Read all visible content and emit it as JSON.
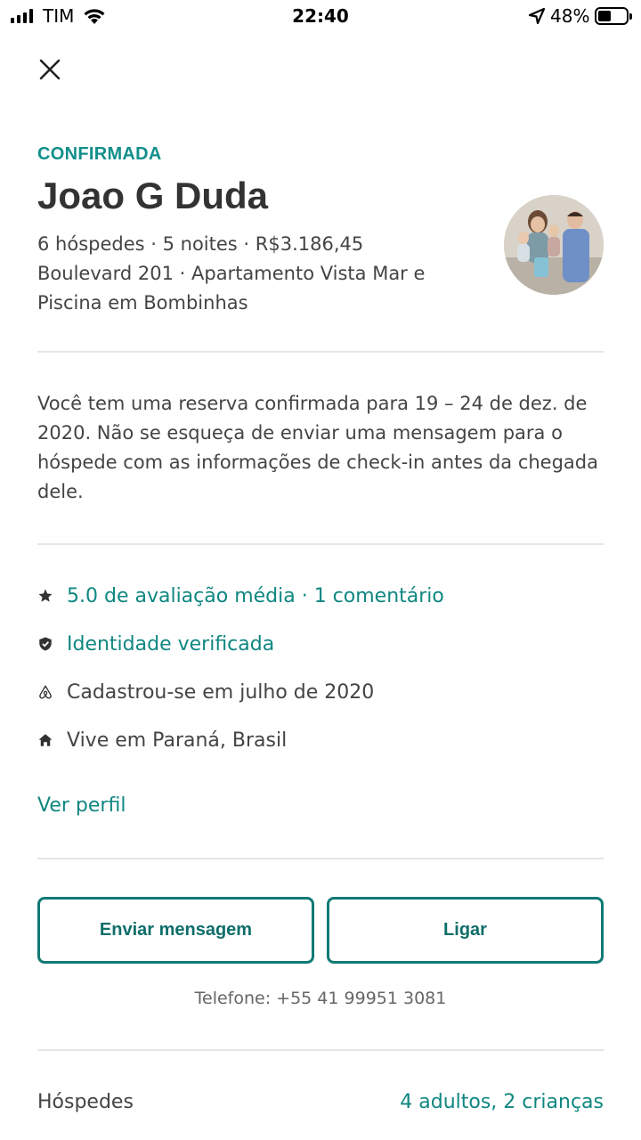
{
  "status_bar": {
    "carrier": "TIM",
    "time": "22:40",
    "battery": "48%",
    "battery_level": 0.48,
    "icons": [
      "signal-icon",
      "wifi-icon",
      "location-arrow-icon",
      "battery-icon"
    ]
  },
  "header": {
    "close_icon": "close-icon"
  },
  "reservation": {
    "status": "CONFIRMADA",
    "guest_name": "Joao G Duda",
    "summary_line": "6 hóspedes · 5 noites · R$3.186,45",
    "listing": "Boulevard 201 · Apartamento Vista Mar e Piscina em Bombinhas",
    "notice": "Você tem uma reserva confirmada para 19 – 24 de dez. de 2020. Não se esqueça de enviar uma mensagem para o hóspede com as informações de check-in antes da chegada dele."
  },
  "guest_info": {
    "items": [
      {
        "icon": "star-icon",
        "text": "5.0 de avaliação média · 1 comentário"
      },
      {
        "icon": "shield-check-icon",
        "text": "Identidade verificada"
      },
      {
        "icon": "airbnb-logo-icon",
        "text": "Cadastrou-se em julho de 2020"
      },
      {
        "icon": "home-icon",
        "text": "Vive em Paraná, Brasil"
      }
    ],
    "profile_link": "Ver perfil"
  },
  "actions": {
    "message_label": "Enviar mensagem",
    "call_label": "Ligar",
    "phone": "Telefone: +55 41 99951 3081"
  },
  "guests": {
    "label": "Hóspedes",
    "value": "4 adultos, 2 crianças"
  },
  "colors": {
    "accent": "#0f8781",
    "button_border": "#0f7a75",
    "text": "#444444",
    "divider": "#e6e6e6"
  }
}
